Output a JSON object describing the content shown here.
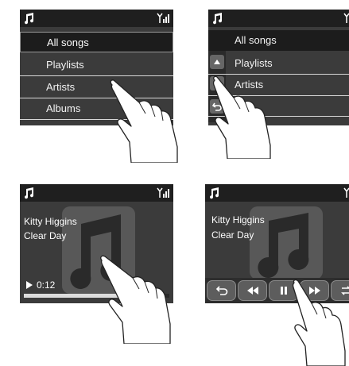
{
  "screens": [
    {
      "menu": {
        "items": [
          {
            "label": "All songs"
          },
          {
            "label": "Playlists"
          },
          {
            "label": "Artists"
          },
          {
            "label": "Albums"
          }
        ]
      }
    },
    {
      "menu": {
        "items": [
          {
            "label": "All songs"
          },
          {
            "label": "Playlists"
          },
          {
            "label": "Artists"
          }
        ]
      }
    },
    {
      "track": {
        "artist": "Kitty Higgins",
        "title": "Clear Day"
      },
      "progress": {
        "time": "0:12",
        "fraction": 0.85
      }
    },
    {
      "track": {
        "artist": "Kitty Higgins",
        "title": "Clear Day"
      }
    }
  ],
  "icons": {
    "music": "music-note-icon",
    "signal": "signal-icon",
    "up": "arrow-up-icon",
    "down": "arrow-down-icon",
    "back": "back-icon",
    "prev": "previous-track-icon",
    "pause": "pause-icon",
    "next": "next-track-icon",
    "repeat": "repeat-icon",
    "play": "play-icon"
  },
  "colors": {
    "panel": "#3b3b3b",
    "statusbar": "#1f1f1f",
    "text": "#f2f2f2"
  }
}
